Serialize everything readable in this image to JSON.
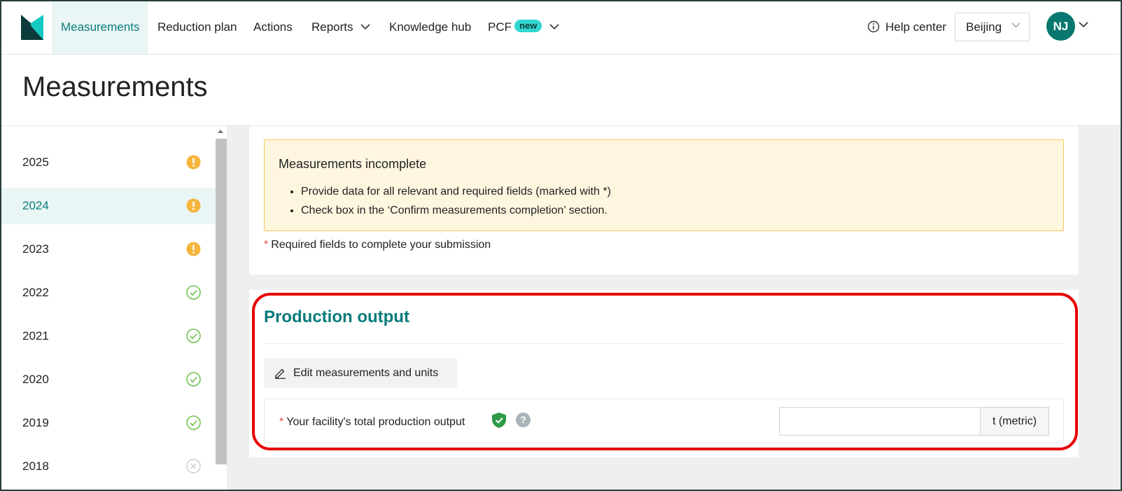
{
  "nav": {
    "items": [
      {
        "label": "Measurements",
        "active": true
      },
      {
        "label": "Reduction plan"
      },
      {
        "label": "Actions"
      },
      {
        "label": "Reports",
        "has_dropdown": true
      },
      {
        "label": "Knowledge hub"
      },
      {
        "label": "PCF",
        "badge": "new",
        "has_dropdown": true
      }
    ],
    "help_label": "Help center",
    "location": "Beijing",
    "avatar_initials": "NJ"
  },
  "page_title": "Measurements",
  "sidebar": {
    "years": [
      {
        "label": "2025",
        "status": "warning-icon"
      },
      {
        "label": "2024",
        "status": "warning-icon",
        "active": true
      },
      {
        "label": "2023",
        "status": "warning-icon"
      },
      {
        "label": "2022",
        "status": "check-circle-icon"
      },
      {
        "label": "2021",
        "status": "check-circle-icon"
      },
      {
        "label": "2020",
        "status": "check-circle-icon"
      },
      {
        "label": "2019",
        "status": "check-circle-icon"
      },
      {
        "label": "2018",
        "status": "x-circle-icon"
      }
    ]
  },
  "alert": {
    "title": "Measurements incomplete",
    "items": [
      "Provide data for all relevant and required fields (marked with *)",
      "Check box in the ‘Confirm measurements completion’ section."
    ]
  },
  "required_note": "Required fields to complete your submission",
  "required_star": "*",
  "production": {
    "title": "Production output",
    "edit_label": "Edit measurements and units",
    "field_label": "Your facility's total production output",
    "help_mark": "?",
    "value": "",
    "unit": "t (metric)"
  },
  "colors": {
    "brand": "#087a7a",
    "warning": "#f5b53d",
    "success": "#6ec14b",
    "highlight": "#e80000"
  }
}
